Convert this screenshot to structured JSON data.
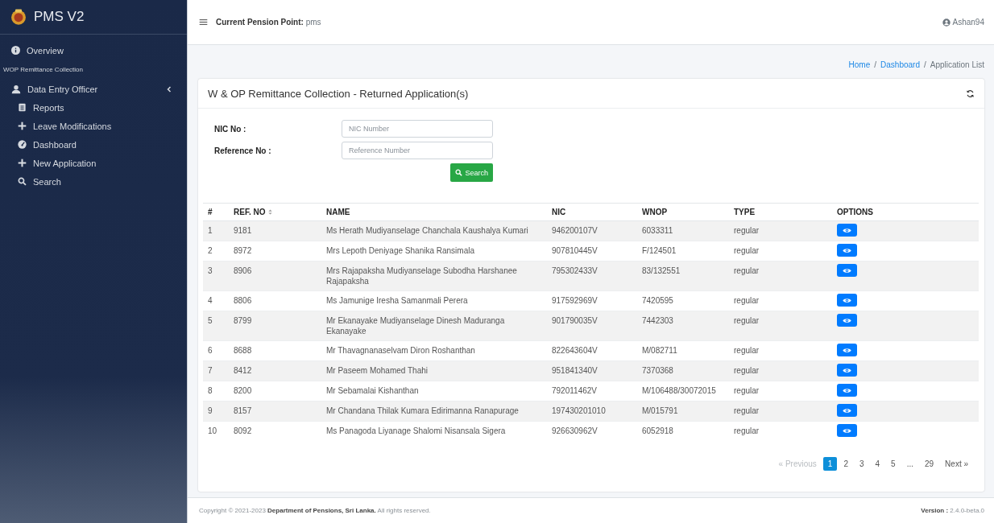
{
  "sidebar": {
    "brand": "PMS V2",
    "items": [
      {
        "label": "Overview",
        "kind": "link"
      },
      {
        "label": "WOP Remittance Collection",
        "kind": "header"
      },
      {
        "label": "Data Entry Officer",
        "kind": "group",
        "children": [
          {
            "label": "Reports",
            "kind": "link"
          },
          {
            "label": "Leave Modifications",
            "kind": "link"
          },
          {
            "label": "Dashboard",
            "kind": "link"
          },
          {
            "label": "New Application",
            "kind": "link"
          },
          {
            "label": "Search",
            "kind": "link"
          }
        ]
      }
    ]
  },
  "topbar": {
    "pension_point": "**Current Pension Point:** pms",
    "user": "Ashan94"
  },
  "breadcrumb": [
    {
      "label": "Home",
      "kind": "link",
      "current": false
    },
    {
      "label": "/",
      "kind": "separator"
    },
    {
      "label": "Dashboard",
      "kind": "link",
      "current": false
    },
    {
      "label": "/",
      "kind": "separator"
    },
    {
      "label": "Application List",
      "kind": "link",
      "current": true
    }
  ],
  "card": {
    "title": "W & OP Remittance Collection - Returned Application(s)",
    "form": {
      "fields": [
        {
          "label": "NIC No :",
          "placeholder": "NIC Number"
        },
        {
          "label": "Reference No :",
          "placeholder": "Reference Number"
        }
      ],
      "search_button": "Search"
    },
    "table": {
      "columns": [
        {
          "label": "#",
          "sortable": false
        },
        {
          "label": "REF. NO",
          "sortable": true
        },
        {
          "label": "NAME",
          "sortable": false
        },
        {
          "label": "NIC",
          "sortable": false
        },
        {
          "label": "WNOP",
          "sortable": false
        },
        {
          "label": "TYPE",
          "sortable": false
        },
        {
          "label": "OPTIONS",
          "sortable": false
        }
      ],
      "rows": [
        {
          "no": "1",
          "ref": "9181",
          "name": "Ms Herath Mudiyanselage Chanchala Kaushalya Kumari",
          "nic": "946200107V",
          "wnop": "6033311",
          "type": "regular"
        },
        {
          "no": "2",
          "ref": "8972",
          "name": "Mrs Lepoth Deniyage Shanika Ransimala",
          "nic": "907810445V",
          "wnop": "F/124501",
          "type": "regular"
        },
        {
          "no": "3",
          "ref": "8906",
          "name": "Mrs Rajapaksha Mudiyanselage Subodha Harshanee Rajapaksha",
          "nic": "795302433V",
          "wnop": "83/132551",
          "type": "regular"
        },
        {
          "no": "4",
          "ref": "8806",
          "name": "Ms Jamunige Iresha Samanmali Perera",
          "nic": "917592969V",
          "wnop": "7420595",
          "type": "regular"
        },
        {
          "no": "5",
          "ref": "8799",
          "name": "Mr Ekanayake Mudiyanselage Dinesh Maduranga Ekanayake",
          "nic": "901790035V",
          "wnop": "7442303",
          "type": "regular"
        },
        {
          "no": "6",
          "ref": "8688",
          "name": "Mr Thavagnanaselvam Diron Roshanthan",
          "nic": "822643604V",
          "wnop": "M/082711",
          "type": "regular"
        },
        {
          "no": "7",
          "ref": "8412",
          "name": "Mr Paseem Mohamed Thahi",
          "nic": "951841340V",
          "wnop": "7370368",
          "type": "regular"
        },
        {
          "no": "8",
          "ref": "8200",
          "name": "Mr Sebamalai Kishanthan",
          "nic": "792011462V",
          "wnop": "M/106488/30072015",
          "type": "regular"
        },
        {
          "no": "9",
          "ref": "8157",
          "name": "Mr Chandana Thilak Kumara Edirimanna Ranapurage",
          "nic": "197430201010",
          "wnop": "M/015791",
          "type": "regular"
        },
        {
          "no": "10",
          "ref": "8092",
          "name": "Ms Panagoda Liyanage Shalomi Nisansala Sigera",
          "nic": "926630962V",
          "wnop": "6052918",
          "type": "regular"
        }
      ]
    },
    "pagination": {
      "previous": {
        "label": "« Previous",
        "disabled": true
      },
      "pages": [
        {
          "label": "1",
          "kind": "page",
          "selected": true
        },
        {
          "label": "2",
          "kind": "page",
          "selected": false
        },
        {
          "label": "3",
          "kind": "page",
          "selected": false
        },
        {
          "label": "4",
          "kind": "page",
          "selected": false
        },
        {
          "label": "5",
          "kind": "page",
          "selected": false
        },
        {
          "label": "...",
          "kind": "ellipsis"
        },
        {
          "label": "29",
          "kind": "page",
          "selected": false
        }
      ],
      "next": {
        "label": "Next »",
        "disabled": false
      }
    }
  },
  "footer": {
    "copyright": "Copyright © 2021-2023 **Department of Pensions, Sri Lanka.** All rights reserved.",
    "version": "**Version :** 2.4.0-beta.0"
  }
}
